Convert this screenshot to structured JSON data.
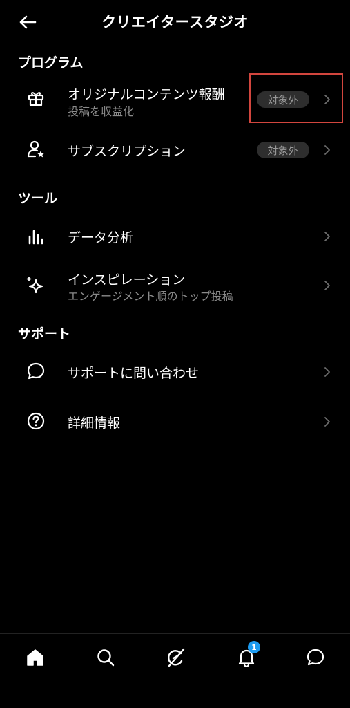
{
  "header": {
    "title": "クリエイタースタジオ",
    "back_icon": "arrow-left-icon"
  },
  "sections": {
    "program": {
      "title": "プログラム",
      "items": [
        {
          "label": "オリジナルコンテンツ報酬",
          "sub": "投稿を収益化",
          "badge": "対象外",
          "icon": "gift-icon"
        },
        {
          "label": "サブスクリプション",
          "badge": "対象外",
          "icon": "person-star-icon"
        }
      ]
    },
    "tools": {
      "title": "ツール",
      "items": [
        {
          "label": "データ分析",
          "icon": "analytics-icon"
        },
        {
          "label": "インスピレーション",
          "sub": "エンゲージメント順のトップ投稿",
          "icon": "sparkle-icon"
        }
      ]
    },
    "support": {
      "title": "サポート",
      "items": [
        {
          "label": "サポートに問い合わせ",
          "icon": "chat-bubble-icon"
        },
        {
          "label": "詳細情報",
          "icon": "help-circle-icon"
        }
      ]
    }
  },
  "bottom_nav": {
    "items": [
      "home-icon",
      "search-icon",
      "grok-icon",
      "bell-icon",
      "messages-icon"
    ],
    "notification_count": "1"
  },
  "colors": {
    "background": "#000000",
    "badge_bg": "#2e2e2e",
    "highlight": "#d2463e",
    "notif": "#1d9bf0"
  }
}
